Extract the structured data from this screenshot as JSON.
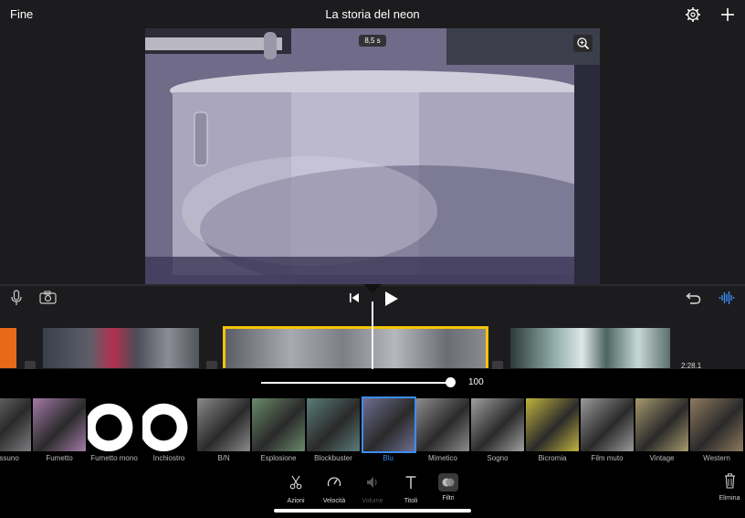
{
  "topbar": {
    "done_label": "Fine",
    "title": "La storia del neon"
  },
  "viewer": {
    "duration_badge": "8,5 s"
  },
  "timeline": {
    "clip_time": "2:28.1"
  },
  "slider": {
    "value": "100",
    "fraction": 1.0
  },
  "filters": [
    {
      "label": "Nessuno",
      "tone": "#7d7d80"
    },
    {
      "label": "Fumetto",
      "tone": "#a47aa8"
    },
    {
      "label": "Fumetto mono",
      "tone": "#ffffff"
    },
    {
      "label": "Inchiostro",
      "tone": "#f0f0f0"
    },
    {
      "label": "B/N",
      "tone": "#8a8a8a"
    },
    {
      "label": "Esplosione",
      "tone": "#6a8a6a"
    },
    {
      "label": "Blockbuster",
      "tone": "#5a7c78"
    },
    {
      "label": "Blu",
      "tone": "#6f6e91"
    },
    {
      "label": "Mimetico",
      "tone": "#8d8d8d"
    },
    {
      "label": "Sogno",
      "tone": "#a0a0a0"
    },
    {
      "label": "Bicromia",
      "tone": "#c2b43e"
    },
    {
      "label": "Film muto",
      "tone": "#9a9a9a"
    },
    {
      "label": "Vintage",
      "tone": "#a79a6e"
    },
    {
      "label": "Western",
      "tone": "#8f7a5e"
    }
  ],
  "tabs": {
    "azioni": "Azioni",
    "velocita": "Velocità",
    "volume": "Volume",
    "titoli": "Titoli",
    "filtri": "Filtri"
  },
  "delete_label": "Elimina",
  "colors": {
    "accent": "#3d8ef5",
    "clip_selected": "#f5c400"
  }
}
